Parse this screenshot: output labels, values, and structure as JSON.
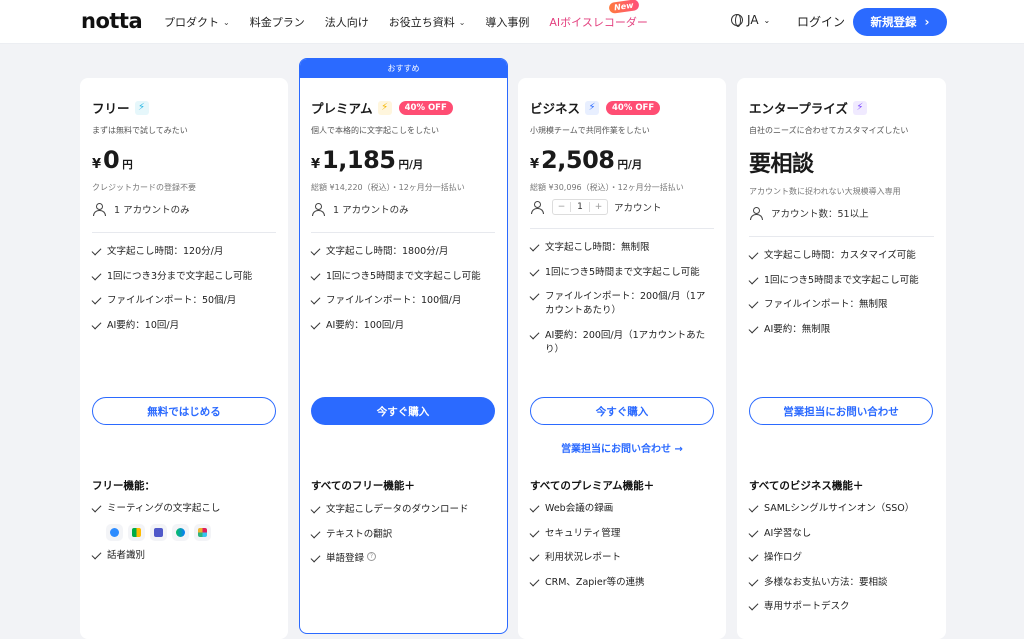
{
  "header": {
    "logo": "notta",
    "nav": [
      {
        "label": "プロダクト",
        "dropdown": true
      },
      {
        "label": "料金プラン",
        "dropdown": false
      },
      {
        "label": "法人向け",
        "dropdown": false
      },
      {
        "label": "お役立ち資料",
        "dropdown": true
      },
      {
        "label": "導入事例",
        "dropdown": false
      },
      {
        "label": "AIボイスレコーダー",
        "dropdown": false
      }
    ],
    "new_badge": "New",
    "lang": "JA",
    "login": "ログイン",
    "signup": "新規登録"
  },
  "colors": {
    "accent": "#2b6aff",
    "off_badge": "#ff4d73",
    "ai_link": "#e3417f"
  },
  "plans": {
    "free": {
      "name": "フリー",
      "desc": "まずは無料で試してみたい",
      "currency": "¥",
      "price": "0",
      "unit": "円",
      "note": "クレジットカードの登録不要",
      "accounts": "1 アカウントのみ",
      "features": [
        "文字起こし時間：120分/月",
        "1回につき3分まで文字起こし可能",
        "ファイルインポート：50個/月",
        "AI要約：10回/月"
      ],
      "cta": "無料ではじめる",
      "extras_title": "フリー機能：",
      "extras": [
        "ミーティングの文字起こし",
        "話者識別"
      ]
    },
    "premium": {
      "recommended": "おすすめ",
      "name": "プレミアム",
      "off": "40% OFF",
      "desc": "個人で本格的に文字起こしをしたい",
      "currency": "¥",
      "price": "1,185",
      "unit": "円/月",
      "note": "総額 ¥14,220（税込）・12ヶ月分一括払い",
      "accounts": "1 アカウントのみ",
      "features": [
        "文字起こし時間：1800分/月",
        "1回につき5時間まで文字起こし可能",
        "ファイルインポート：100個/月",
        "AI要約：100回/月"
      ],
      "cta": "今すぐ購入",
      "extras_title": "すべてのフリー機能＋",
      "extras": [
        "文字起こしデータのダウンロード",
        "テキストの翻訳",
        "単語登録"
      ],
      "help_icon": "?"
    },
    "business": {
      "name": "ビジネス",
      "off": "40% OFF",
      "desc": "小規模チームで共同作業をしたい",
      "currency": "¥",
      "price": "2,508",
      "unit": "円/月",
      "note": "総額 ¥30,096（税込）・12ヶ月分一括払い",
      "stepper_minus": "−",
      "stepper_value": "1",
      "stepper_plus": "+",
      "accounts_suffix": "アカウント",
      "features": [
        "文字起こし時間：無制限",
        "1回につき5時間まで文字起こし可能",
        "ファイルインポート：200個/月（1アカウントあたり）",
        "AI要約：200回/月（1アカウントあたり）"
      ],
      "cta": "今すぐ購入",
      "contact": "営業担当にお問い合わせ →",
      "extras_title": "すべてのプレミアム機能＋",
      "extras": [
        "Web会議の録画",
        "セキュリティ管理",
        "利用状況レポート",
        "CRM、Zapier等の連携"
      ]
    },
    "enterprise": {
      "name": "エンタープライズ",
      "desc": "自社のニーズに合わせてカスタマイズしたい",
      "price_text": "要相談",
      "note": "アカウント数に捉われない大規模導入専用",
      "accounts": "アカウント数：51以上",
      "features": [
        "文字起こし時間：カスタマイズ可能",
        "1回につき5時間まで文字起こし可能",
        "ファイルインポート：無制限",
        "AI要約：無制限"
      ],
      "cta": "営業担当にお問い合わせ",
      "extras_title": "すべてのビジネス機能＋",
      "extras": [
        "SAMLシングルサインオン（SSO）",
        "AI学習なし",
        "操作ログ",
        "多様なお支払い方法：要相談",
        "専用サポートデスク"
      ]
    }
  },
  "integration_icons": [
    "zoom-icon",
    "google-meet-icon",
    "teams-icon",
    "webex-icon",
    "slack-icon"
  ]
}
